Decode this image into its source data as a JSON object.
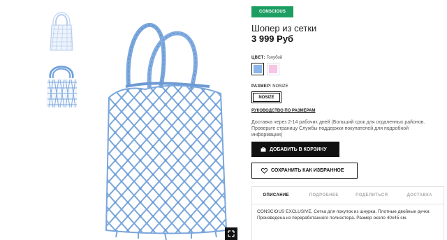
{
  "product": {
    "badge": "CONSCIOUS",
    "title": "Шопер из сетки",
    "price": "3 999 Руб"
  },
  "color": {
    "label": "ЦВЕТ:",
    "value": "Голубой",
    "swatches": [
      {
        "name": "Голубой",
        "hex": "#8ab4ea",
        "selected": true
      },
      {
        "name": "Розовый",
        "hex": "#f7c3e6",
        "selected": false
      }
    ]
  },
  "size": {
    "label": "РАЗМЕР:",
    "value": "NOSIZE",
    "button": "NOSIZE"
  },
  "size_guide": "РУКОВОДСТВО ПО РАЗМЕРАМ",
  "delivery_text": "Доставка через 2-14 рабочих дней (Больший срок для отдаленных районов. Проверьте страницу Службы поддержки покупателей для подробной информации)",
  "actions": {
    "add_to_cart": "ДОБАВИТЬ В КОРЗИНУ",
    "save_favorite": "СОХРАНИТЬ КАК ИЗБРАННОЕ"
  },
  "tabs": [
    "ОПИСАНИЕ",
    "ПОДРОБНЕЕ",
    "ПОДЕЛИТЬСЯ",
    "ДОСТАВКА"
  ],
  "description": "CONSCIOUS EXCLUSIVE. Сетка для покупок из шнурка. Плотные двойные ручки. Произведена из переработанного полиэстера. Размер около 40x45 см.",
  "colors": {
    "badge_green": "#1c9e63",
    "bag_blue": "#7aa7dc",
    "button_black": "#111111"
  }
}
